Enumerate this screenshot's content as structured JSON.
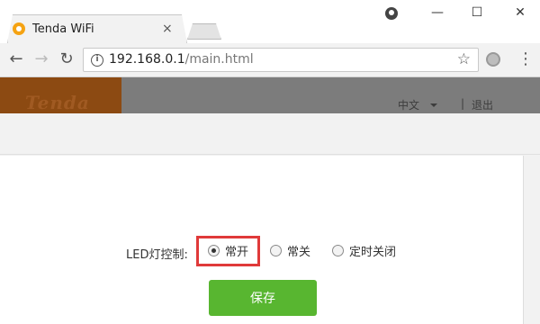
{
  "browser": {
    "tab_title": "Tenda WiFi",
    "tab_close": "×",
    "window_controls": {
      "minimize": "—",
      "maximize": "☐",
      "close": "✕"
    },
    "url_host": "192.168.0.1",
    "url_path": "/main.html"
  },
  "header": {
    "logo": "Tenda",
    "language": "中文",
    "separator": "|",
    "logout": "退出"
  },
  "led_control": {
    "label": "LED灯控制:",
    "options": [
      {
        "label": "常开",
        "checked": true
      },
      {
        "label": "常关",
        "checked": false
      },
      {
        "label": "定时关闭",
        "checked": false
      }
    ]
  },
  "save_button": "保存",
  "colors": {
    "header_bg": "#7c7c7c",
    "logo_bg": "#8c4a12",
    "save_green": "#58b630",
    "highlight_red": "#e03a3a"
  },
  "icons": [
    "tenda-favicon-icon",
    "profile-icon",
    "back-arrow-icon",
    "forward-arrow-icon",
    "reload-icon",
    "info-icon",
    "star-icon",
    "extension-icon",
    "menu-icon",
    "caret-down-icon"
  ]
}
